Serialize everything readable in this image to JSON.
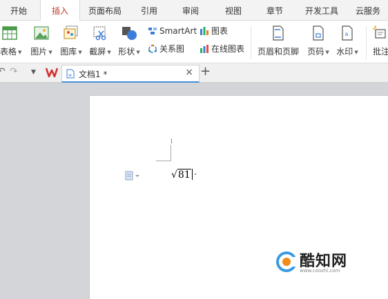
{
  "menu": {
    "tabs": [
      {
        "label": "开始"
      },
      {
        "label": "插入",
        "active": true
      },
      {
        "label": "页面布局"
      },
      {
        "label": "引用"
      },
      {
        "label": "审阅"
      },
      {
        "label": "视图"
      },
      {
        "label": "章节"
      },
      {
        "label": "开发工具"
      },
      {
        "label": "云服务"
      }
    ]
  },
  "ribbon": {
    "table": "表格",
    "picture": "图片",
    "gallery": "图库",
    "screenshot": "截屏",
    "shapes": "形状",
    "smartart": "SmartArt",
    "relation": "关系图",
    "chart": "图表",
    "online_chart": "在线图表",
    "header_footer": "页眉和页脚",
    "page_number": "页码",
    "watermark": "水印",
    "comment": "批注"
  },
  "doc_tab": {
    "title": "文档1 *",
    "close": "×",
    "add": "+"
  },
  "document": {
    "page_number": "1",
    "formula_radicand": "81",
    "paragraph_mark": "·"
  },
  "watermark_logo": {
    "name": "酷知网",
    "url": "www.coozhi.com"
  },
  "colors": {
    "accent": "#c0392b",
    "tab_underline": "#4a8fd8",
    "workspace": "#d3d5d9"
  }
}
